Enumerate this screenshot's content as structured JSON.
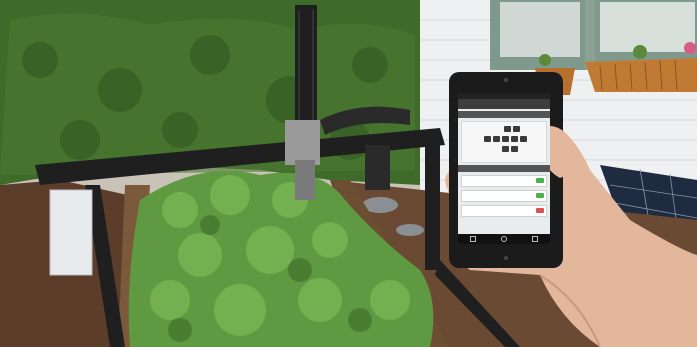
{
  "scene": {
    "subjects": [
      "garden-robot",
      "raised-garden-bed",
      "hedge",
      "house-wall",
      "window-planters",
      "solar-panel",
      "smartphone",
      "hand"
    ]
  },
  "phone_app": {
    "screen": "robot-control",
    "keypad_keys": 6,
    "toggles": 3
  },
  "colors": {
    "hedge": "#3f6b2a",
    "plants": "#5f9a42",
    "soil": "#6b4a34",
    "robot_frame": "#1f1f1f",
    "house": "#eef0f2",
    "phone": "#1b1b1b",
    "skin": "#e3b79c",
    "toggle_on": "#4caf50"
  }
}
